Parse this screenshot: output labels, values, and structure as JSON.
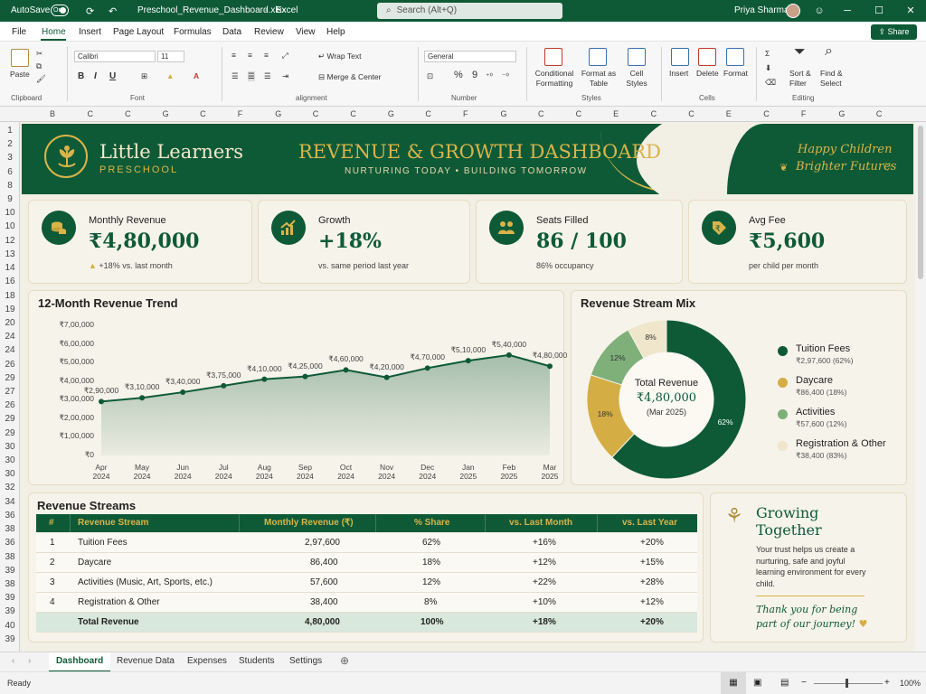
{
  "app": {
    "autosave_label": "AutoSave",
    "autosave_state": "On",
    "filename": "Preschool_Revenue_Dashboard.xlsx",
    "app_name": "Excel",
    "search_placeholder": "Search (Alt+Q)",
    "user_name": "Priya Sharma"
  },
  "menu": {
    "items": [
      "File",
      "Home",
      "Insert",
      "Page Layout",
      "Formulas",
      "Data",
      "Review",
      "View",
      "Help"
    ],
    "active": "Home",
    "share_label": "Share"
  },
  "ribbon": {
    "paste_label": "Paste",
    "clipboard_label": "Clipboard",
    "font_name": "Calibri",
    "font_size": "11",
    "font_label": "Font",
    "bold": "B",
    "italic": "I",
    "underline": "U",
    "wrap_text": "Wrap Text",
    "merge_center": "Merge & Center",
    "alignment_label": "alignment",
    "number_format": "General",
    "number_label": "Number",
    "percent": "%",
    "comma": "9",
    "conditional_formatting": [
      "Conditional",
      "Formatting"
    ],
    "format_as_table": [
      "Format as",
      "Table"
    ],
    "cell_styles": [
      "Cell",
      "Styles"
    ],
    "styles_label": "Styles",
    "insert": "Insert",
    "delete": "Delete",
    "format": "Format",
    "cells_label": "Cells",
    "sort_filter": [
      "Sort &",
      "Filter"
    ],
    "find_select": [
      "Find &",
      "Select"
    ],
    "editing_label": "Editing"
  },
  "grid": {
    "columns": [
      "B",
      "C",
      "C",
      "G",
      "C",
      "F",
      "G",
      "C",
      "C",
      "G",
      "C",
      "F",
      "G",
      "C",
      "C",
      "E",
      "C",
      "C",
      "E",
      "C",
      "F",
      "G",
      "C"
    ],
    "rows": [
      "1",
      "2",
      "3",
      "6",
      "8",
      "9",
      "10",
      "10",
      "12",
      "13",
      "14",
      "16",
      "18",
      "19",
      "20",
      "24",
      "24",
      "26",
      "29",
      "27",
      "26",
      "29",
      "29",
      "30",
      "30",
      "30",
      "32",
      "34",
      "36",
      "38",
      "36",
      "38",
      "39",
      "38",
      "39",
      "39",
      "40",
      "39"
    ]
  },
  "banner": {
    "brand_title": "Little Learners",
    "brand_subtitle": "PRESCHOOL",
    "dashboard_title": "REVENUE & GROWTH DASHBOARD",
    "dashboard_subtitle": "NURTURING TODAY  •  BUILDING TOMORROW",
    "tagline_line1": "Happy Children",
    "tagline_line2": "Brighter Futures"
  },
  "kpis": [
    {
      "label": "Monthly Revenue",
      "value": "₹4,80,000",
      "sub": "+18% vs. last month",
      "icon": "coins-icon"
    },
    {
      "label": "Growth",
      "value": "+18%",
      "sub": "vs. same period last year",
      "icon": "growth-chart-icon"
    },
    {
      "label": "Seats Filled",
      "value": "86 / 100",
      "sub": "86% occupancy",
      "icon": "children-icon"
    },
    {
      "label": "Avg Fee",
      "value": "₹5,600",
      "sub": "per child per month",
      "icon": "rupee-tag-icon"
    }
  ],
  "trend": {
    "title": "12-Month Revenue Trend"
  },
  "chart_data": [
    {
      "type": "area",
      "title": "12-Month Revenue Trend",
      "categories": [
        "Apr 2024",
        "May 2024",
        "Jun 2024",
        "Jul 2024",
        "Aug 2024",
        "Sep 2024",
        "Oct 2024",
        "Nov 2024",
        "Dec 2024",
        "Jan 2025",
        "Feb 2025",
        "Mar 2025"
      ],
      "values": [
        290000,
        310000,
        340000,
        375000,
        410000,
        425000,
        460000,
        420000,
        470000,
        510000,
        540000,
        480000
      ],
      "data_labels": [
        "₹2,90,000",
        "₹3,10,000",
        "₹3,40,000",
        "₹3,75,000",
        "₹4,10,000",
        "₹4,25,000",
        "₹4,60,000",
        "₹4,20,000",
        "₹4,70,000",
        "₹5,10,000",
        "₹5,40,000",
        "₹4,80,000"
      ],
      "y_ticks": [
        "₹7,00,000",
        "₹6,00,000",
        "₹5,00,000",
        "₹4,00,000",
        "₹3,00,000",
        "₹2,00,000",
        "₹1,00,000",
        "₹0"
      ],
      "ylim": [
        0,
        700000
      ],
      "grid": false,
      "color": "#0e5a37"
    },
    {
      "type": "pie",
      "title": "Revenue Stream Mix",
      "center_label": "Total Revenue",
      "center_value": "₹4,80,000",
      "center_sub": "(Mar 2025)",
      "slices": [
        {
          "name": "Tuition Fees",
          "detail": "₹2,97,600 (62%)",
          "value": 62,
          "label": "62%",
          "color": "#0e5a37"
        },
        {
          "name": "Daycare",
          "detail": "₹86,400 (18%)",
          "value": 18,
          "label": "18%",
          "color": "#d4ae45"
        },
        {
          "name": "Activities",
          "detail": "₹57,600 (12%)",
          "value": 12,
          "label": "12%",
          "color": "#7fb07a"
        },
        {
          "name": "Registration & Other",
          "detail": "₹38,400 (83%)",
          "value": 8,
          "label": "8%",
          "color": "#efe6cc"
        }
      ],
      "legend": "right"
    }
  ],
  "streams": {
    "title": "Revenue Streams",
    "headers": [
      "#",
      "Revenue Stream",
      "Monthly Revenue (₹)",
      "% Share",
      "vs. Last Month",
      "vs. Last Year"
    ],
    "rows": [
      [
        "1",
        "Tuition Fees",
        "2,97,600",
        "62%",
        "+16%",
        "+20%"
      ],
      [
        "2",
        "Daycare",
        "86,400",
        "18%",
        "+12%",
        "+15%"
      ],
      [
        "3",
        "Activities (Music, Art, Sports, etc.)",
        "57,600",
        "12%",
        "+22%",
        "+28%"
      ],
      [
        "4",
        "Registration & Other",
        "38,400",
        "8%",
        "+10%",
        "+12%"
      ]
    ],
    "total": [
      "",
      "Total Revenue",
      "4,80,000",
      "100%",
      "+18%",
      "+20%"
    ]
  },
  "growing": {
    "title_line1": "Growing",
    "title_line2": "Together",
    "body": "Your trust helps us create a nurturing, safe and joyful learning environment for every child.",
    "thanks_line1": "Thank you for being",
    "thanks_line2": "part of our journey!"
  },
  "sheets": {
    "tabs": [
      "Dashboard",
      "Revenue Data",
      "Expenses",
      "Students",
      "Settings"
    ],
    "active": "Dashboard"
  },
  "status": {
    "ready": "Ready",
    "zoom": "100%"
  },
  "colors": {
    "brand_green": "#0e5a37",
    "gold": "#d9b44a",
    "cream": "#f2efe4"
  }
}
